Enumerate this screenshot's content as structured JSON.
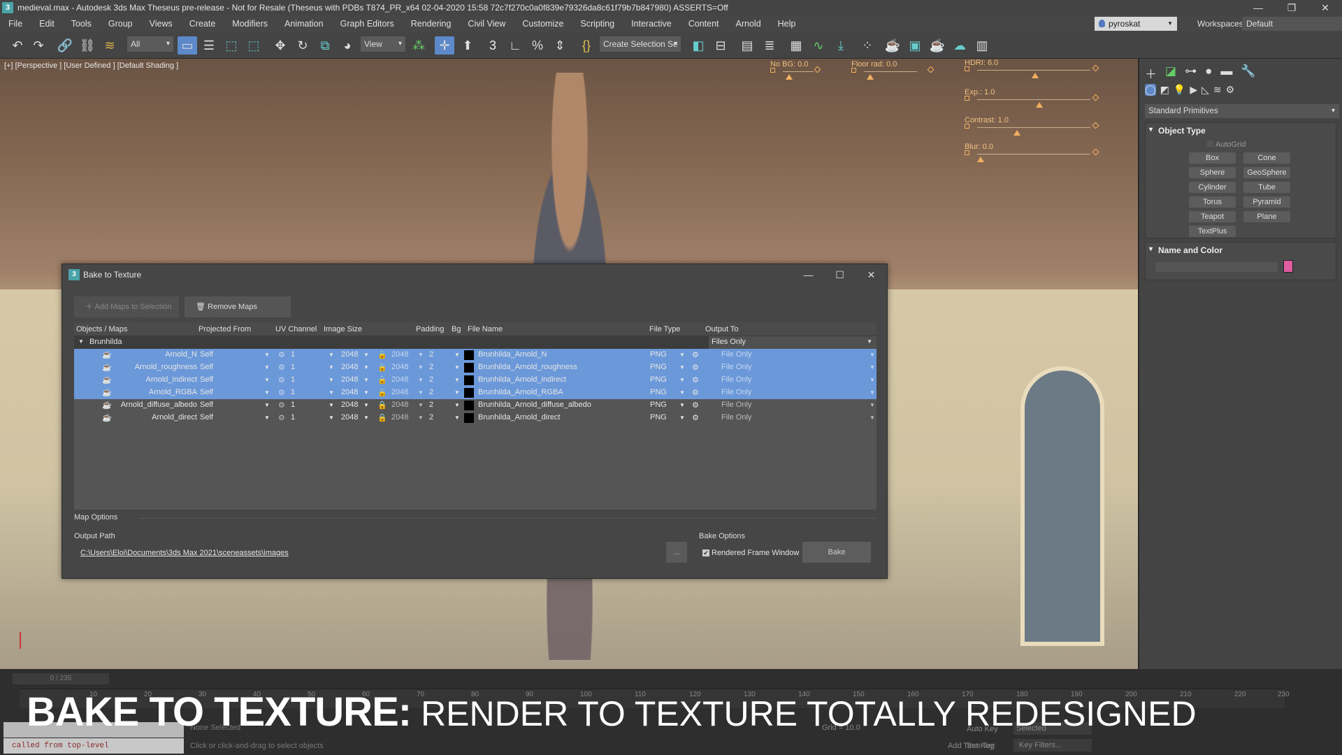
{
  "window": {
    "title": "medieval.max - Autodesk 3ds Max Theseus pre-release - Not for Resale (Theseus with PDBs T874_PR_x64 02-04-2020 15:58 72c7f270c0a0f839e79326da8c61f79b7b847980) ASSERTS=Off",
    "app_icon": "3",
    "min": "—",
    "max": "❐",
    "close": "✕"
  },
  "menu": {
    "items": [
      "File",
      "Edit",
      "Tools",
      "Group",
      "Views",
      "Create",
      "Modifiers",
      "Animation",
      "Graph Editors",
      "Rendering",
      "Civil View",
      "Customize",
      "Scripting",
      "Interactive",
      "Content",
      "Arnold",
      "Help"
    ],
    "user": "pyroskat",
    "workspaces_label": "Workspaces:",
    "workspace": "Default"
  },
  "toolbar": {
    "selection_filter": "All",
    "ref_coord": "View",
    "named_selection": "Create Selection Se"
  },
  "viewport": {
    "label": "[+] [Perspective ] [User Defined ] [Default Shading ]",
    "hud": {
      "no_bg": "No BG: 0.0",
      "floor_rad": "Floor rad: 0.0",
      "hdri": "HDRI: 6.0",
      "exp": "Exp.: 1.0",
      "contrast": "Contrast: 1.0",
      "blur": "Blur: 0.0"
    }
  },
  "command_panel": {
    "category": "Standard Primitives",
    "object_type": {
      "title": "Object Type",
      "autogrid": "AutoGrid",
      "buttons": [
        "Box",
        "Cone",
        "Sphere",
        "GeoSphere",
        "Cylinder",
        "Tube",
        "Torus",
        "Pyramid",
        "Teapot",
        "Plane",
        "TextPlus"
      ]
    },
    "name_and_color": {
      "title": "Name and Color",
      "color": "#e05ca0"
    }
  },
  "dialog": {
    "title": "Bake to Texture",
    "add_maps": "Add Maps to Selection",
    "remove_maps": "Remove Maps",
    "columns": [
      "Objects / Maps",
      "Projected From",
      "UV Channel",
      "Image Size",
      "Padding",
      "Bg",
      "File Name",
      "File Type",
      "Output To"
    ],
    "group": {
      "name": "Brunhilda",
      "output": "Files Only"
    },
    "rows": [
      {
        "map": "Arnold_N",
        "projected": "Self",
        "uv": "1",
        "size": "2048",
        "size2": "2048",
        "padding": "2",
        "file": "Brunhilda_Arnold_N",
        "type": "PNG",
        "output": "File Only",
        "selected": true
      },
      {
        "map": "Arnold_roughness",
        "projected": "Self",
        "uv": "1",
        "size": "2048",
        "size2": "2048",
        "padding": "2",
        "file": "Brunhilda_Arnold_roughness",
        "type": "PNG",
        "output": "File Only",
        "selected": true
      },
      {
        "map": "Arnold_indirect",
        "projected": "Self",
        "uv": "1",
        "size": "2048",
        "size2": "2048",
        "padding": "2",
        "file": "Brunhilda_Arnold_indirect",
        "type": "PNG",
        "output": "File Only",
        "selected": true
      },
      {
        "map": "Arnold_RGBA",
        "projected": "Self",
        "uv": "1",
        "size": "2048",
        "size2": "2048",
        "padding": "2",
        "file": "Brunhilda_Arnold_RGBA",
        "type": "PNG",
        "output": "File Only",
        "selected": true
      },
      {
        "map": "Arnold_diffuse_albedo",
        "projected": "Self",
        "uv": "1",
        "size": "2048",
        "size2": "2048",
        "padding": "2",
        "file": "Brunhilda_Arnold_diffuse_albedo",
        "type": "PNG",
        "output": "File Only",
        "selected": false
      },
      {
        "map": "Arnold_direct",
        "projected": "Self",
        "uv": "1",
        "size": "2048",
        "size2": "2048",
        "padding": "2",
        "file": "Brunhilda_Arnold_direct",
        "type": "PNG",
        "output": "File Only",
        "selected": false
      }
    ],
    "map_options": "Map Options",
    "output_path_label": "Output Path",
    "output_path": "C:\\Users\\Eloi\\Documents\\3ds Max 2021\\sceneassets\\images",
    "browse": "...",
    "bake_options_label": "Bake Options",
    "rendered_frame_window": "Rendered Frame Window",
    "rendered_frame_window_checked": true,
    "bake": "Bake"
  },
  "timeline": {
    "frame": "0 / 235",
    "ticks": [
      "10",
      "20",
      "30",
      "40",
      "50",
      "60",
      "70",
      "80",
      "90",
      "100",
      "110",
      "120",
      "130",
      "140",
      "150",
      "160",
      "170",
      "180",
      "190",
      "200",
      "210",
      "220",
      "230"
    ],
    "status_line": "called from top-level",
    "selection": "None Selected",
    "prompt": "Click or click-and-drag to select objects",
    "grid": "Grid = 10.0",
    "add_time_tag": "Add Time Tag",
    "auto_key": "Auto Key",
    "key_mode": "Selected",
    "set_key": "Set Key",
    "key_filters": "Key Filters..."
  },
  "caption": {
    "bold": "BAKE TO TEXTURE:",
    "thin": "RENDER TO TEXTURE TOTALLY REDESIGNED"
  }
}
